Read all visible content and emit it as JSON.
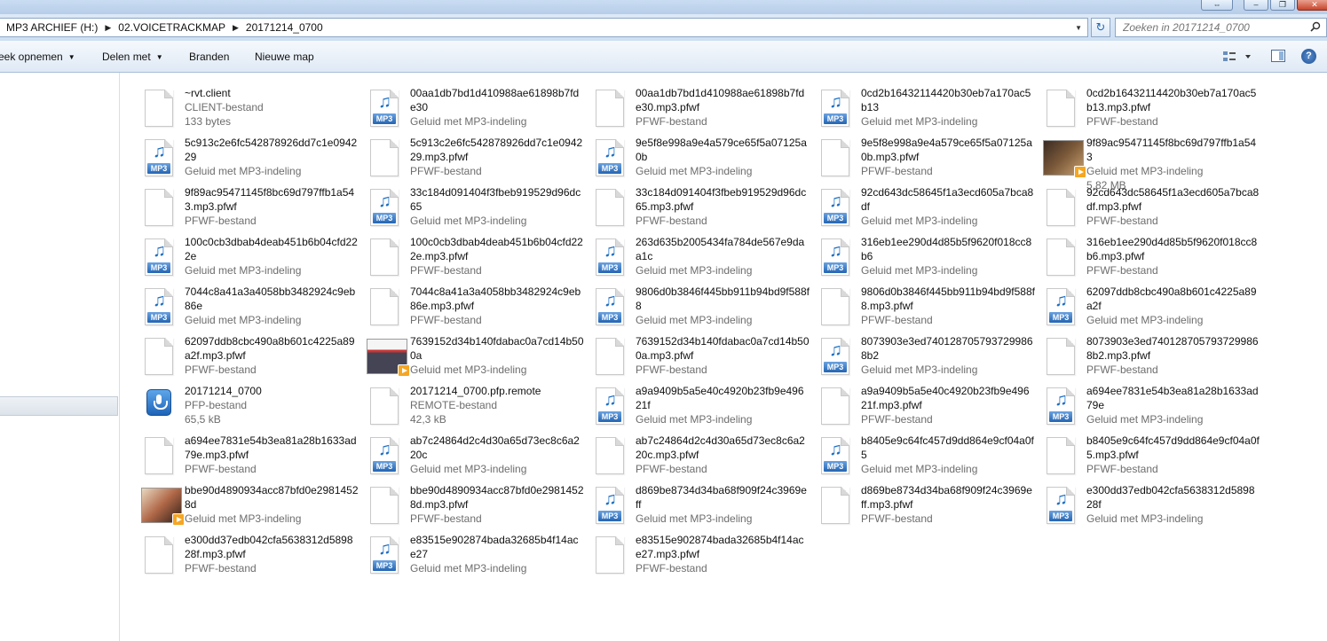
{
  "address": {
    "crumbs": [
      "MP3 ARCHIEF (H:)",
      "02.VOICETRACKMAP",
      "20171214_0700"
    ],
    "search_placeholder": "Zoeken in 20171214_0700"
  },
  "commands": {
    "record": "eek opnemen",
    "share": "Delen met",
    "burn": "Branden",
    "new_folder": "Nieuwe map"
  },
  "colors": {
    "accent": "#1c6fc4",
    "secondary_text": "#6d6d6d"
  },
  "files": [
    {
      "name": "~rvt.client",
      "sub1": "CLIENT-bestand",
      "sub2": "133 bytes",
      "icon": "document-icon"
    },
    {
      "name": "00aa1db7bd1d410988ae61898b7fde30",
      "sub1": "Geluid met MP3-indeling",
      "sub2": "",
      "icon": "mp3-icon"
    },
    {
      "name": "00aa1db7bd1d410988ae61898b7fde30.mp3.pfwf",
      "sub1": "PFWF-bestand",
      "sub2": "",
      "icon": "document-icon"
    },
    {
      "name": "0cd2b16432114420b30eb7a170ac5b13",
      "sub1": "Geluid met MP3-indeling",
      "sub2": "",
      "icon": "mp3-icon"
    },
    {
      "name": "0cd2b16432114420b30eb7a170ac5b13.mp3.pfwf",
      "sub1": "PFWF-bestand",
      "sub2": "",
      "icon": "document-icon"
    },
    {
      "name": "5c913c2e6fc542878926dd7c1e094229",
      "sub1": "Geluid met MP3-indeling",
      "sub2": "",
      "icon": "mp3-icon"
    },
    {
      "name": "5c913c2e6fc542878926dd7c1e094229.mp3.pfwf",
      "sub1": "PFWF-bestand",
      "sub2": "",
      "icon": "document-icon"
    },
    {
      "name": "9e5f8e998a9e4a579ce65f5a07125a0b",
      "sub1": "Geluid met MP3-indeling",
      "sub2": "",
      "icon": "mp3-icon"
    },
    {
      "name": "9e5f8e998a9e4a579ce65f5a07125a0b.mp3.pfwf",
      "sub1": "PFWF-bestand",
      "sub2": "",
      "icon": "document-icon"
    },
    {
      "name": "9f89ac95471145f8bc69d797ffb1a543",
      "sub1": "Geluid met MP3-indeling",
      "sub2": "5,82 MB",
      "icon": "album-art-thumbnail-icon"
    },
    {
      "name": "9f89ac95471145f8bc69d797ffb1a543.mp3.pfwf",
      "sub1": "PFWF-bestand",
      "sub2": "",
      "icon": "document-icon"
    },
    {
      "name": "33c184d091404f3fbeb919529d96dc65",
      "sub1": "Geluid met MP3-indeling",
      "sub2": "",
      "icon": "mp3-icon"
    },
    {
      "name": "33c184d091404f3fbeb919529d96dc65.mp3.pfwf",
      "sub1": "PFWF-bestand",
      "sub2": "",
      "icon": "document-icon"
    },
    {
      "name": "92cd643dc58645f1a3ecd605a7bca8df",
      "sub1": "Geluid met MP3-indeling",
      "sub2": "",
      "icon": "mp3-icon"
    },
    {
      "name": "92cd643dc58645f1a3ecd605a7bca8df.mp3.pfwf",
      "sub1": "PFWF-bestand",
      "sub2": "",
      "icon": "document-icon"
    },
    {
      "name": "100c0cb3dbab4deab451b6b04cfd222e",
      "sub1": "Geluid met MP3-indeling",
      "sub2": "",
      "icon": "mp3-icon"
    },
    {
      "name": "100c0cb3dbab4deab451b6b04cfd222e.mp3.pfwf",
      "sub1": "PFWF-bestand",
      "sub2": "",
      "icon": "document-icon"
    },
    {
      "name": "263d635b2005434fa784de567e9daa1c",
      "sub1": "Geluid met MP3-indeling",
      "sub2": "",
      "icon": "mp3-icon"
    },
    {
      "name": "316eb1ee290d4d85b5f9620f018cc8b6",
      "sub1": "Geluid met MP3-indeling",
      "sub2": "",
      "icon": "mp3-icon"
    },
    {
      "name": "316eb1ee290d4d85b5f9620f018cc8b6.mp3.pfwf",
      "sub1": "PFWF-bestand",
      "sub2": "",
      "icon": "document-icon"
    },
    {
      "name": "7044c8a41a3a4058bb3482924c9eb86e",
      "sub1": "Geluid met MP3-indeling",
      "sub2": "",
      "icon": "mp3-icon"
    },
    {
      "name": "7044c8a41a3a4058bb3482924c9eb86e.mp3.pfwf",
      "sub1": "PFWF-bestand",
      "sub2": "",
      "icon": "document-icon"
    },
    {
      "name": "9806d0b3846f445bb911b94bd9f588f8",
      "sub1": "Geluid met MP3-indeling",
      "sub2": "",
      "icon": "mp3-icon"
    },
    {
      "name": "9806d0b3846f445bb911b94bd9f588f8.mp3.pfwf",
      "sub1": "PFWF-bestand",
      "sub2": "",
      "icon": "document-icon"
    },
    {
      "name": "62097ddb8cbc490a8b601c4225a89a2f",
      "sub1": "Geluid met MP3-indeling",
      "sub2": "",
      "icon": "mp3-icon"
    },
    {
      "name": "62097ddb8cbc490a8b601c4225a89a2f.mp3.pfwf",
      "sub1": "PFWF-bestand",
      "sub2": "",
      "icon": "document-icon"
    },
    {
      "name": "7639152d34b140fdabac0a7cd14b500a",
      "sub1": "Geluid met MP3-indeling",
      "sub2": "",
      "icon": "album-art-thumbnail-icon"
    },
    {
      "name": "7639152d34b140fdabac0a7cd14b500a.mp3.pfwf",
      "sub1": "PFWF-bestand",
      "sub2": "",
      "icon": "document-icon"
    },
    {
      "name": "8073903e3ed7401287057937299868b2",
      "sub1": "Geluid met MP3-indeling",
      "sub2": "",
      "icon": "mp3-icon"
    },
    {
      "name": "8073903e3ed7401287057937299868b2.mp3.pfwf",
      "sub1": "PFWF-bestand",
      "sub2": "",
      "icon": "document-icon"
    },
    {
      "name": "20171214_0700",
      "sub1": "PFP-bestand",
      "sub2": "65,5 kB",
      "icon": "microphone-icon"
    },
    {
      "name": "20171214_0700.pfp.remote",
      "sub1": "REMOTE-bestand",
      "sub2": "42,3 kB",
      "icon": "document-icon"
    },
    {
      "name": "a9a9409b5a5e40c4920b23fb9e49621f",
      "sub1": "Geluid met MP3-indeling",
      "sub2": "",
      "icon": "mp3-icon"
    },
    {
      "name": "a9a9409b5a5e40c4920b23fb9e49621f.mp3.pfwf",
      "sub1": "PFWF-bestand",
      "sub2": "",
      "icon": "document-icon"
    },
    {
      "name": "a694ee7831e54b3ea81a28b1633ad79e",
      "sub1": "Geluid met MP3-indeling",
      "sub2": "",
      "icon": "mp3-icon"
    },
    {
      "name": "a694ee7831e54b3ea81a28b1633ad79e.mp3.pfwf",
      "sub1": "PFWF-bestand",
      "sub2": "",
      "icon": "document-icon"
    },
    {
      "name": "ab7c24864d2c4d30a65d73ec8c6a220c",
      "sub1": "Geluid met MP3-indeling",
      "sub2": "",
      "icon": "mp3-icon"
    },
    {
      "name": "ab7c24864d2c4d30a65d73ec8c6a220c.mp3.pfwf",
      "sub1": "PFWF-bestand",
      "sub2": "",
      "icon": "document-icon"
    },
    {
      "name": "b8405e9c64fc457d9dd864e9cf04a0f5",
      "sub1": "Geluid met MP3-indeling",
      "sub2": "",
      "icon": "mp3-icon"
    },
    {
      "name": "b8405e9c64fc457d9dd864e9cf04a0f5.mp3.pfwf",
      "sub1": "PFWF-bestand",
      "sub2": "",
      "icon": "document-icon"
    },
    {
      "name": "bbe90d4890934acc87bfd0e29814528d",
      "sub1": "Geluid met MP3-indeling",
      "sub2": "",
      "icon": "album-art-thumbnail-icon"
    },
    {
      "name": "bbe90d4890934acc87bfd0e29814528d.mp3.pfwf",
      "sub1": "PFWF-bestand",
      "sub2": "",
      "icon": "document-icon"
    },
    {
      "name": "d869be8734d34ba68f909f24c3969eff",
      "sub1": "Geluid met MP3-indeling",
      "sub2": "",
      "icon": "mp3-icon"
    },
    {
      "name": "d869be8734d34ba68f909f24c3969eff.mp3.pfwf",
      "sub1": "PFWF-bestand",
      "sub2": "",
      "icon": "document-icon"
    },
    {
      "name": "e300dd37edb042cfa5638312d589828f",
      "sub1": "Geluid met MP3-indeling",
      "sub2": "",
      "icon": "mp3-icon"
    },
    {
      "name": "e300dd37edb042cfa5638312d589828f.mp3.pfwf",
      "sub1": "PFWF-bestand",
      "sub2": "",
      "icon": "document-icon"
    },
    {
      "name": "e83515e902874bada32685b4f14ace27",
      "sub1": "Geluid met MP3-indeling",
      "sub2": "",
      "icon": "mp3-icon"
    },
    {
      "name": "e83515e902874bada32685b4f14ace27.mp3.pfwf",
      "sub1": "PFWF-bestand",
      "sub2": "",
      "icon": "document-icon"
    }
  ]
}
